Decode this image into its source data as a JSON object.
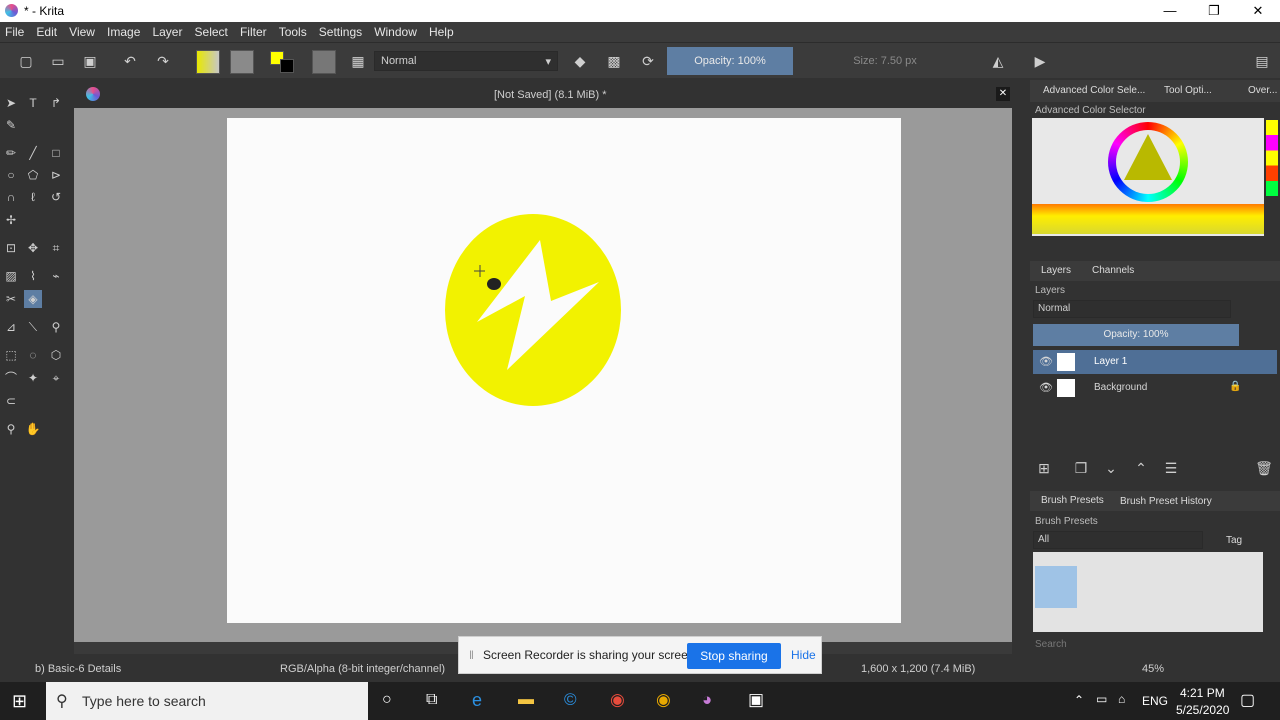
{
  "window": {
    "title": "* - Krita",
    "minimize": "—",
    "restore": "❐",
    "close": "✕"
  },
  "menu": [
    "File",
    "Edit",
    "View",
    "Image",
    "Layer",
    "Select",
    "Filter",
    "Tools",
    "Settings",
    "Window",
    "Help"
  ],
  "toolbar": {
    "blend_mode": "Normal",
    "opacity": "Opacity: 100%",
    "size": "Size: 7.50 px"
  },
  "document": {
    "title": "[Not Saved]  (8.1 MiB) *"
  },
  "dock": {
    "top_tabs": [
      "Advanced Color Sele...",
      "Tool Opti...",
      "Over..."
    ],
    "color_selector_title": "Advanced Color Selector",
    "layer_tabs": [
      "Layers",
      "Channels"
    ],
    "layers_title": "Layers",
    "layer_blend": "Normal",
    "layer_opacity": "Opacity:  100%",
    "layers": [
      "Layer 1",
      "Background"
    ],
    "brush_tabs": [
      "Brush Presets",
      "Brush Preset History"
    ],
    "brush_title": "Brush Presets",
    "brush_filter": "All",
    "brush_tag": "Tag",
    "brush_search": "Search"
  },
  "status": {
    "brush": "b) Basic-6 Details",
    "colorspace": "RGB/Alpha (8-bit integer/channel)",
    "dimensions": "1,600 x 1,200 (7.4 MiB)",
    "zoom": "45%"
  },
  "share_notice": {
    "text": "Screen Recorder is sharing your screen.",
    "stop": "Stop sharing",
    "hide": "Hide"
  },
  "taskbar": {
    "search_placeholder": "Type here to search",
    "time": "4:21 PM",
    "date": "5/25/2020",
    "lang": "ENG"
  },
  "colors": {
    "fg": "#ffff00",
    "bg": "#000000",
    "accent": "#5e7ea3",
    "logo": "#f2f200"
  }
}
